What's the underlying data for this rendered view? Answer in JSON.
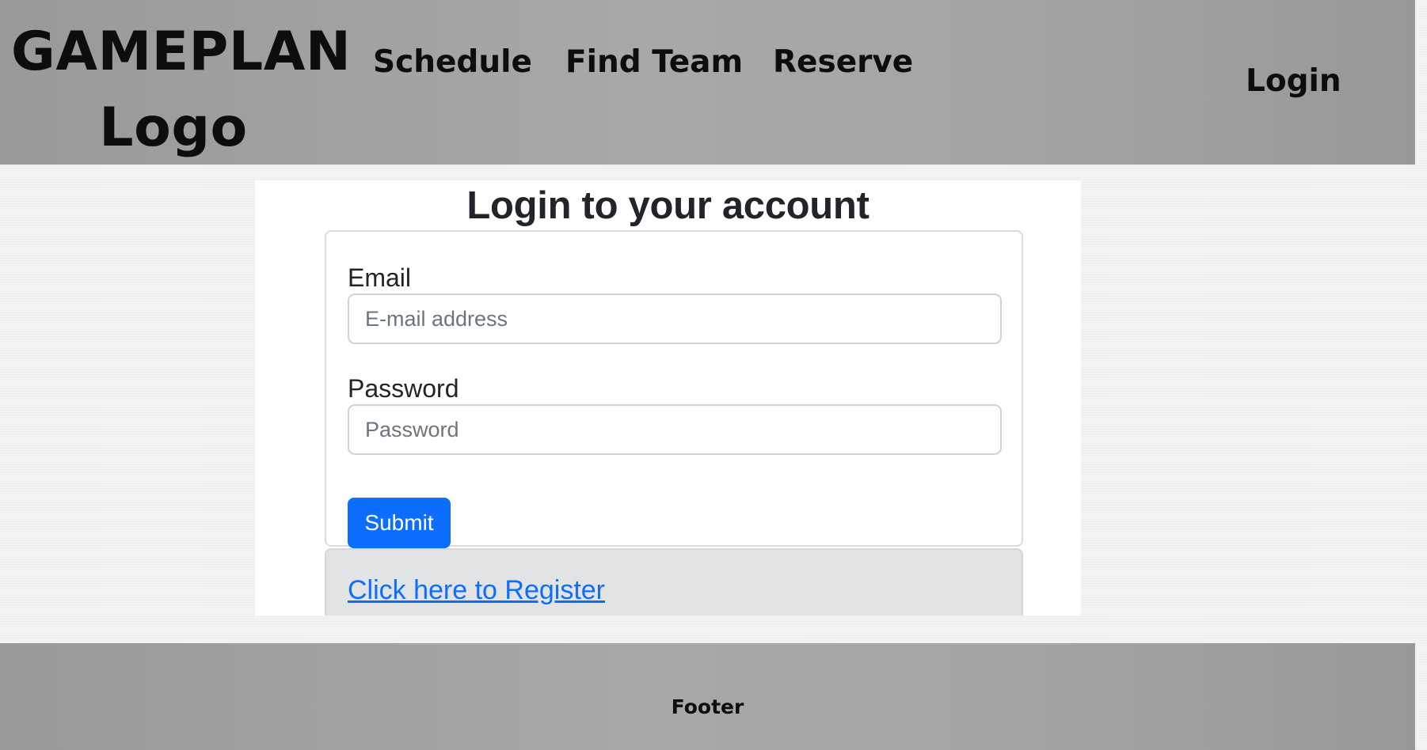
{
  "header": {
    "logo_line1": "GAMEPLAN",
    "logo_line2": "Logo",
    "nav": {
      "schedule": "Schedule",
      "find_team": "Find Team",
      "reserve": "Reserve"
    },
    "login": "Login"
  },
  "form": {
    "title": "Login to your account",
    "email_label": "Email",
    "email_placeholder": "E-mail address",
    "email_value": "",
    "password_label": "Password",
    "password_placeholder": "Password",
    "password_value": "",
    "submit_label": "Submit",
    "register_link": "Click here to Register"
  },
  "footer": {
    "text": "Footer"
  },
  "colors": {
    "primary": "#0d6efd",
    "header_bg": "#a6a5a5",
    "register_bg": "#e2e3e5"
  }
}
